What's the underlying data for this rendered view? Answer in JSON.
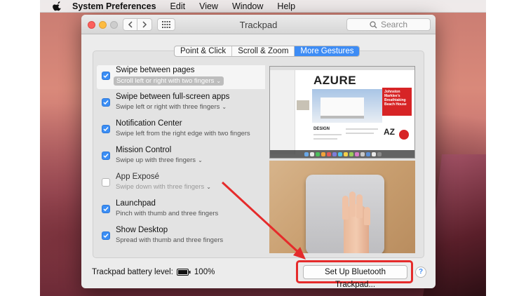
{
  "menubar": {
    "app_name": "System Preferences",
    "items": [
      "Edit",
      "View",
      "Window",
      "Help"
    ]
  },
  "window": {
    "title": "Trackpad",
    "search_placeholder": "Search"
  },
  "tabs": [
    {
      "label": "Point & Click",
      "active": false
    },
    {
      "label": "Scroll & Zoom",
      "active": false
    },
    {
      "label": "More Gestures",
      "active": true
    }
  ],
  "gestures": [
    {
      "title": "Swipe between pages",
      "subtitle": "Scroll left or right with two fingers",
      "checked": true,
      "has_menu": true
    },
    {
      "title": "Swipe between full-screen apps",
      "subtitle": "Swipe left or right with three fingers",
      "checked": true,
      "has_menu": true
    },
    {
      "title": "Notification Center",
      "subtitle": "Swipe left from the right edge with two fingers",
      "checked": true,
      "has_menu": false
    },
    {
      "title": "Mission Control",
      "subtitle": "Swipe up with three fingers",
      "checked": true,
      "has_menu": true
    },
    {
      "title": "App Exposé",
      "subtitle": "Swipe down with three fingers",
      "checked": false,
      "has_menu": true
    },
    {
      "title": "Launchpad",
      "subtitle": "Pinch with thumb and three fingers",
      "checked": true,
      "has_menu": false
    },
    {
      "title": "Show Desktop",
      "subtitle": "Spread with thumb and three fingers",
      "checked": true,
      "has_menu": false
    }
  ],
  "preview": {
    "brand": "AZURE",
    "headline": "Johnston Marklee's Breathtaking Beach House",
    "section": "DESIGN",
    "badge": "AZ"
  },
  "footer": {
    "battery_label": "Trackpad battery level:",
    "battery_value": "100%",
    "setup_button": "Set Up Bluetooth Trackpad...",
    "help": "?"
  },
  "colors": {
    "accent": "#3d8cf5",
    "highlight": "#e52b2b"
  }
}
